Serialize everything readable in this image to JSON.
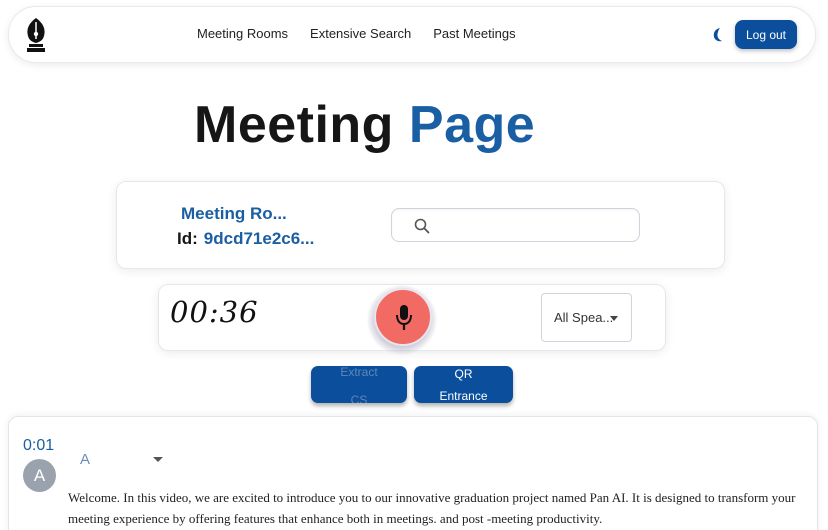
{
  "nav": {
    "links": [
      "Meeting Rooms",
      "Extensive Search",
      "Past Meetings"
    ],
    "logout_label": "Log out",
    "icons": {
      "logo": "fountain-pen-logo",
      "theme": "moon-icon"
    }
  },
  "page": {
    "title_part1": "Meeting",
    "title_part2": "Page"
  },
  "room": {
    "name": "Meeting Ro...",
    "id_label": "Id:",
    "id_value": "9dcd71e2c6..."
  },
  "search": {
    "placeholder": "",
    "value": ""
  },
  "recorder": {
    "timer": "00:36",
    "speaker_filter": "All Spea..."
  },
  "actions": {
    "left_line1": "Extract",
    "left_line2": "CS",
    "right_line1": "QR",
    "right_line2": "Entrance"
  },
  "transcript": {
    "entries": [
      {
        "time": "0:01",
        "avatar_letter": "A",
        "speaker": "A",
        "text": "Welcome. In this video, we are excited to introduce you to our innovative graduation project named Pan AI. It is designed to transform your meeting experience by offering features that enhance both in meetings. and post -meeting productivity."
      }
    ]
  },
  "colors": {
    "brand_blue": "#0b4f9c",
    "title_blue": "#1a5ea3",
    "mic_red": "#f26a64"
  }
}
